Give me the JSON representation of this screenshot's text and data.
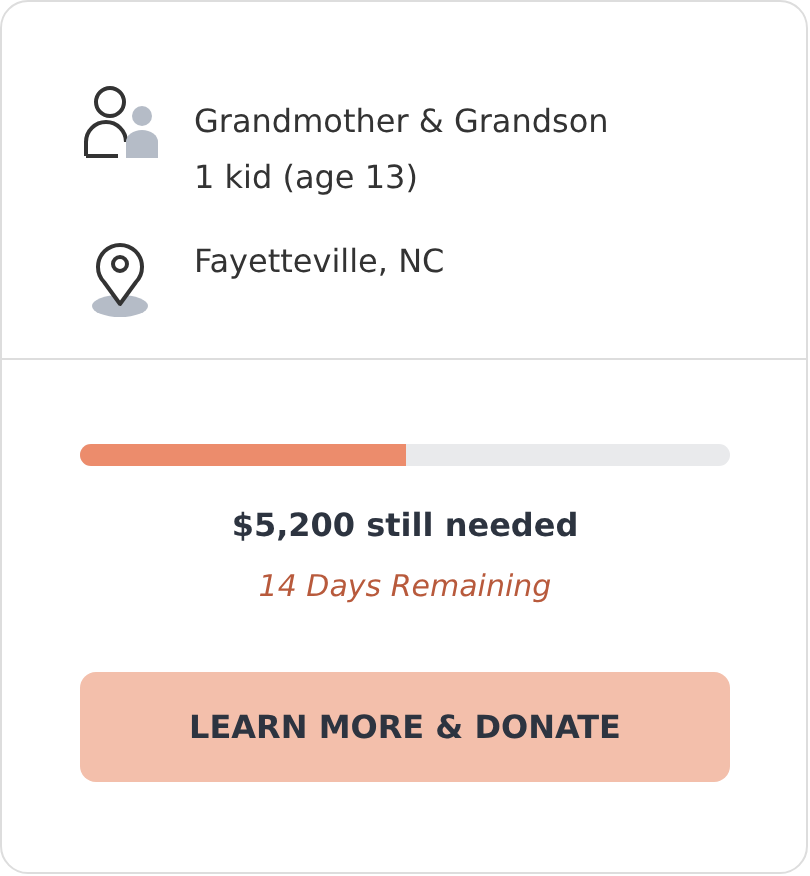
{
  "family": {
    "relation": "Grandmother & Grandson",
    "kids": "1 kid (age 13)"
  },
  "location": "Fayetteville, NC",
  "progress": {
    "level": 0.5
  },
  "needed": "$5,200 still needed",
  "remaining": "14 Days Remaining",
  "button": "LEARN MORE & DONATE"
}
